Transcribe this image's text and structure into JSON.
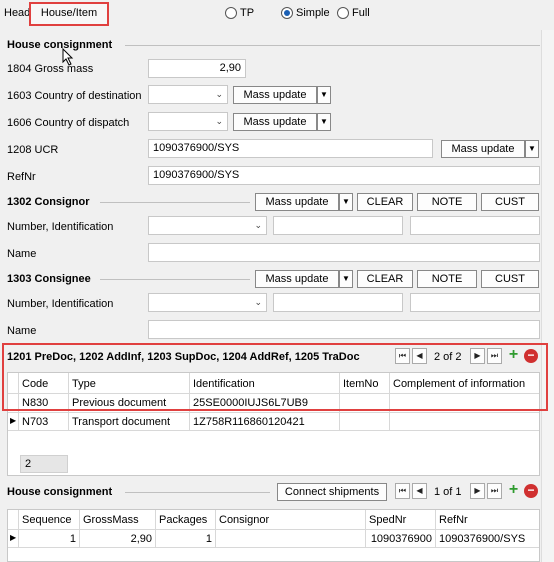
{
  "tabs": {
    "head": "Head",
    "house_item": "House/Item"
  },
  "mode": {
    "tp": "TP",
    "simple": "Simple",
    "full": "Full",
    "selected": "Simple"
  },
  "house_consignment": {
    "title": "House consignment",
    "gross_mass_label": "1804 Gross mass",
    "gross_mass_value": "2,90",
    "country_destination_label": "1603 Country of destination",
    "country_dispatch_label": "1606 Country of dispatch",
    "ucr_label": "1208 UCR",
    "ucr_value": "1090376900/SYS",
    "refnr_label": "RefNr",
    "refnr_value": "1090376900/SYS",
    "mass_update": "Mass update"
  },
  "consignor": {
    "title": "1302 Consignor",
    "number_label": "Number, Identification",
    "name_label": "Name",
    "mass_update": "Mass update",
    "clear": "CLEAR",
    "note": "NOTE",
    "cust": "CUST"
  },
  "consignee": {
    "title": "1303 Consignee",
    "number_label": "Number, Identification",
    "name_label": "Name",
    "mass_update": "Mass update",
    "clear": "CLEAR",
    "note": "NOTE",
    "cust": "CUST"
  },
  "docs": {
    "title": "1201 PreDoc, 1202 AddInf,  1203 SupDoc, 1204 AddRef, 1205 TraDoc",
    "pager": "2 of 2",
    "columns": [
      "Code",
      "Type",
      "Identification",
      "ItemNo",
      "Complement of information"
    ],
    "rows": [
      {
        "code": "N830",
        "type": "Previous document",
        "identification": "25SE0000IUJS6L7UB9",
        "itemno": "",
        "complement": ""
      },
      {
        "code": "N703",
        "type": "Transport document",
        "identification": "1Z758R116860120421",
        "itemno": "",
        "complement": ""
      }
    ],
    "count": "2"
  },
  "house_list": {
    "title": "House consignment",
    "connect": "Connect shipments",
    "pager": "1 of 1",
    "columns": [
      "Sequence",
      "GrossMass",
      "Packages",
      "Consignor",
      "SpedNr",
      "RefNr"
    ],
    "rows": [
      {
        "sequence": "1",
        "grossmass": "2,90",
        "packages": "1",
        "consignor": "",
        "spednr": "1090376900",
        "refnr": "1090376900/SYS"
      }
    ]
  },
  "colors": {
    "highlight": "#e0403f",
    "accent": "#1a5fb4",
    "add": "#2e9b2e",
    "remove": "#d03030"
  }
}
